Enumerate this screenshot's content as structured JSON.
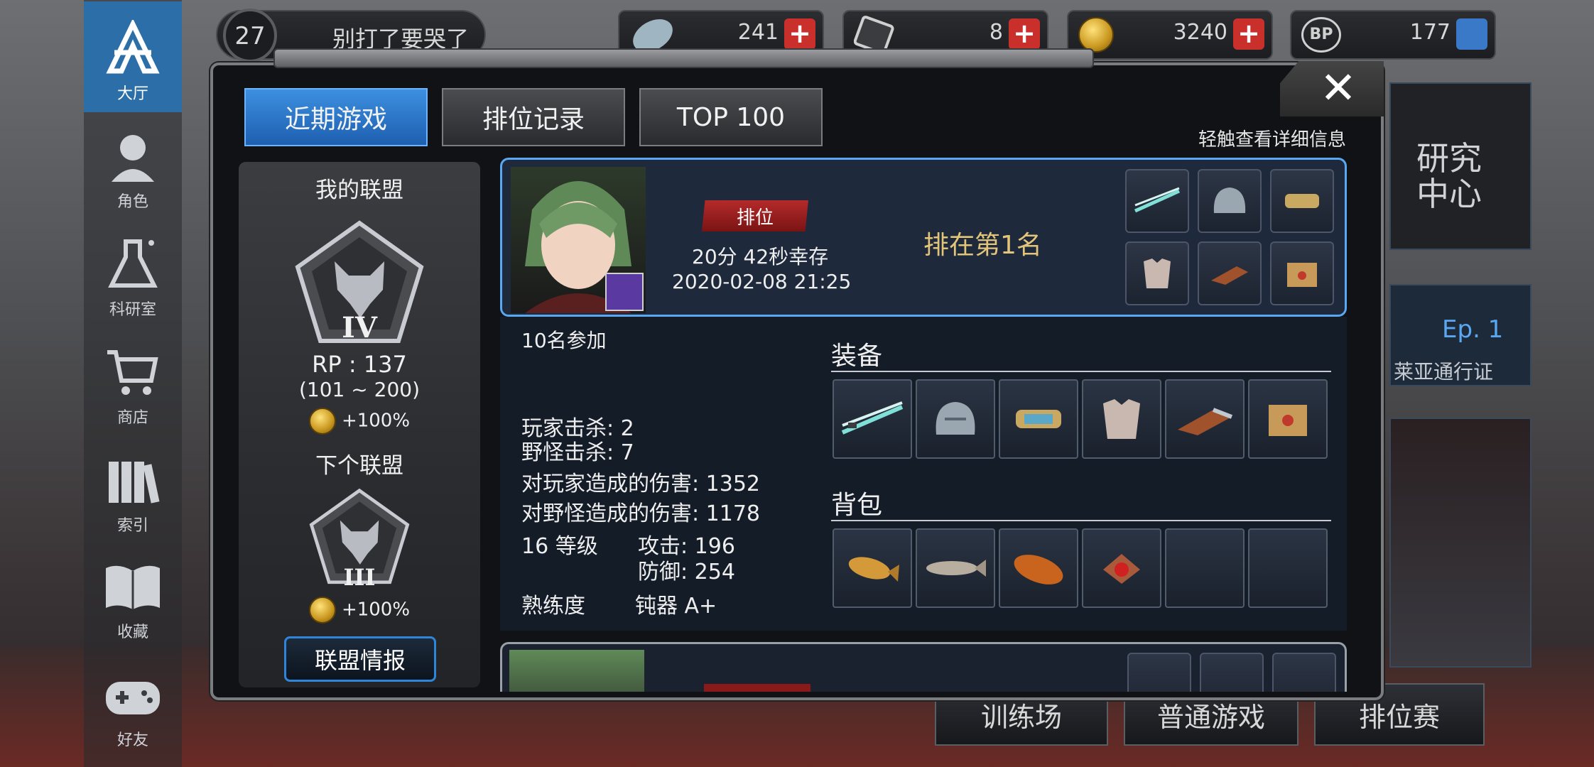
{
  "sidebar": {
    "items": [
      {
        "label": "大厅",
        "icon": "lobby-icon",
        "active": true
      },
      {
        "label": "角色",
        "icon": "character-icon"
      },
      {
        "label": "科研室",
        "icon": "lab-flask-icon"
      },
      {
        "label": "商店",
        "icon": "shop-cart-icon"
      },
      {
        "label": "索引",
        "icon": "index-books-icon"
      },
      {
        "label": "收藏",
        "icon": "collection-book-icon"
      },
      {
        "label": "好友",
        "icon": "friends-gamepad-icon"
      }
    ]
  },
  "topbar": {
    "level": "27",
    "player_name": "别打了要哭了",
    "resources": [
      {
        "name": "crystal",
        "value": "241"
      },
      {
        "name": "ticket",
        "value": "8"
      },
      {
        "name": "gold",
        "value": "3240"
      },
      {
        "name": "bp",
        "value": "177"
      }
    ]
  },
  "background": {
    "research_center": "研究\n中心",
    "ep_label": "Ep. 1",
    "pass_label": "莱亚通行证",
    "bottom_buttons": [
      "训练场",
      "普通游戏",
      "排位赛"
    ]
  },
  "modal": {
    "tabs": [
      "近期游戏",
      "排位记录",
      "TOP 100"
    ],
    "active_tab": 0,
    "hint": "轻触查看详细信息",
    "close_label": "✕",
    "league": {
      "my_title": "我的联盟",
      "my_tier": "IV",
      "rp": "RP : 137",
      "rp_range": "(101 ~ 200)",
      "my_bonus": "+100%",
      "next_title": "下个联盟",
      "next_tier": "III",
      "next_bonus": "+100%",
      "info_button": "联盟情报"
    },
    "match": {
      "mode": "排位",
      "survival": "20分 42秒幸存",
      "datetime": "2020-02-08 21:25",
      "rank_text": "排在第1名",
      "participants": "10名参加",
      "player_kills": "玩家击杀: 2",
      "monster_kills": "野怪击杀: 7",
      "player_damage": "对玩家造成的伤害: 1352",
      "monster_damage": "对野怪造成的伤害: 1178",
      "level": "16 等级",
      "attack": "攻击: 196",
      "defense": "防御: 254",
      "proficiency_label": "熟练度",
      "proficiency_value": "钝器  A+",
      "equipment_title": "装备",
      "backpack_title": "背包",
      "equipment": [
        "dual-blades",
        "helmet",
        "bracer",
        "chest-armor",
        "gauntlet",
        "box-accessory"
      ],
      "backpack": [
        "grilled-fish",
        "dried-fish",
        "roasted-food",
        "red-gem-food",
        "empty",
        "empty"
      ]
    }
  },
  "colors": {
    "accent_blue": "#2f86d8",
    "rank_gold": "#e3c57a",
    "badge_red": "#b52a2a"
  }
}
